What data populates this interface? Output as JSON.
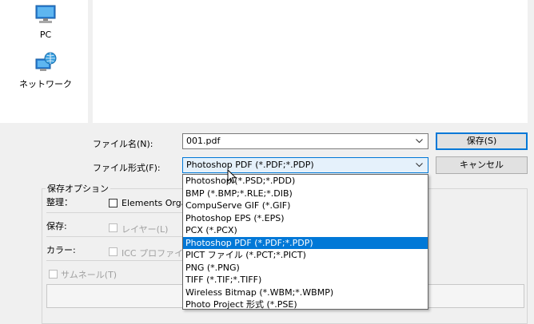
{
  "sidebar": {
    "items": [
      {
        "label": "PC",
        "icon": "pc-icon"
      },
      {
        "label": "ネットワーク",
        "icon": "network-icon"
      }
    ]
  },
  "filename": {
    "label": "ファイル名(N):",
    "value": "001.pdf"
  },
  "filetype": {
    "label": "ファイル形式(F):",
    "value": "Photoshop PDF (*.PDF;*.PDP)"
  },
  "buttons": {
    "save": "保存(S)",
    "cancel": "キャンセル"
  },
  "options": {
    "legend": "保存オプション",
    "organize_label": "整理：",
    "organize_checkbox": "Elements Orga",
    "save_label": "保存:",
    "layers_checkbox": "レイヤー(L)",
    "color_label": "カラー:",
    "icc_checkbox": "ICC プロファイル",
    "thumbnail_checkbox": "サムネール(T)"
  },
  "dropdown": {
    "items": [
      "Photoshop (*.PSD;*.PDD)",
      "BMP (*.BMP;*.RLE;*.DIB)",
      "CompuServe GIF (*.GIF)",
      "Photoshop EPS (*.EPS)",
      "PCX (*.PCX)",
      "Photoshop PDF (*.PDF;*.PDP)",
      "PICT ファイル (*.PCT;*.PICT)",
      "PNG (*.PNG)",
      "TIFF (*.TIF;*.TIFF)",
      "Wireless Bitmap (*.WBM;*.WBMP)",
      "Photo Project 形式 (*.PSE)"
    ],
    "selected_index": 5
  },
  "colors": {
    "selection": "#0078d7",
    "focus_border": "#0078d7"
  }
}
